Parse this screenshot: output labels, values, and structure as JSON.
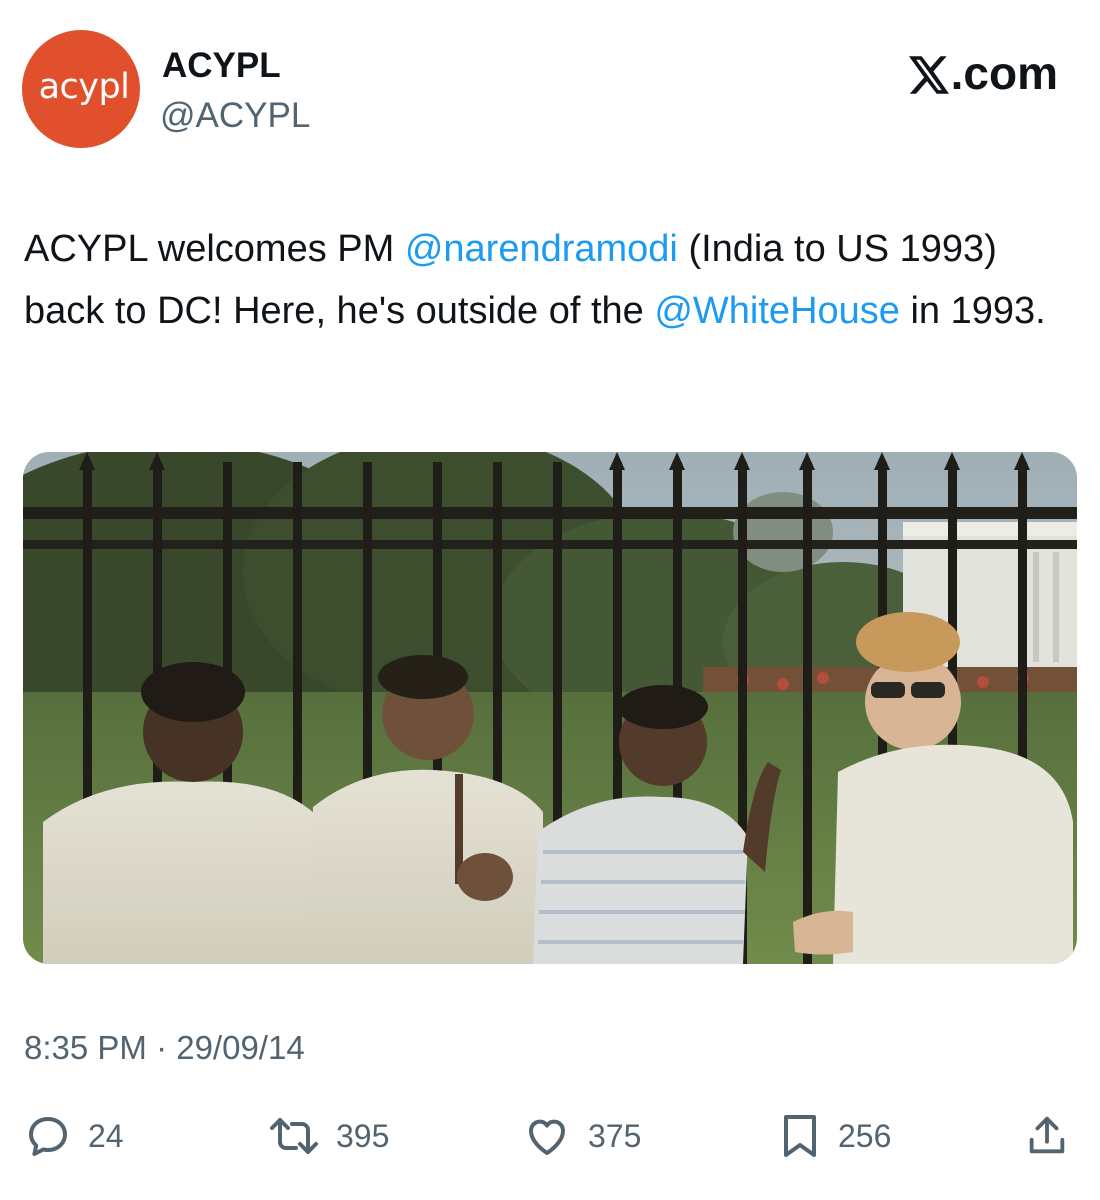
{
  "author": {
    "avatar_text": "acypl",
    "avatar_color": "#e0502c",
    "display_name": "ACYPL",
    "handle": "@ACYPL"
  },
  "brand": {
    "label": ".com",
    "icon": "x-logo-icon"
  },
  "tweet": {
    "text_part1": "ACYPL welcomes PM ",
    "mention1": "@narendramodi",
    "text_part2": " (India to US 1993) back to DC! Here, he's outside of the ",
    "mention2": "@WhiteHouse",
    "text_part3": " in 1993.",
    "mention_color": "#1d9bf0"
  },
  "media": {
    "type": "photo"
  },
  "timestamp": "8:35 PM · 29/09/14",
  "actions": {
    "reply": {
      "icon": "reply-icon",
      "count": "24"
    },
    "retweet": {
      "icon": "retweet-icon",
      "count": "395"
    },
    "like": {
      "icon": "heart-icon",
      "count": "375"
    },
    "bookmark": {
      "icon": "bookmark-icon",
      "count": "256"
    },
    "share": {
      "icon": "share-icon"
    }
  }
}
